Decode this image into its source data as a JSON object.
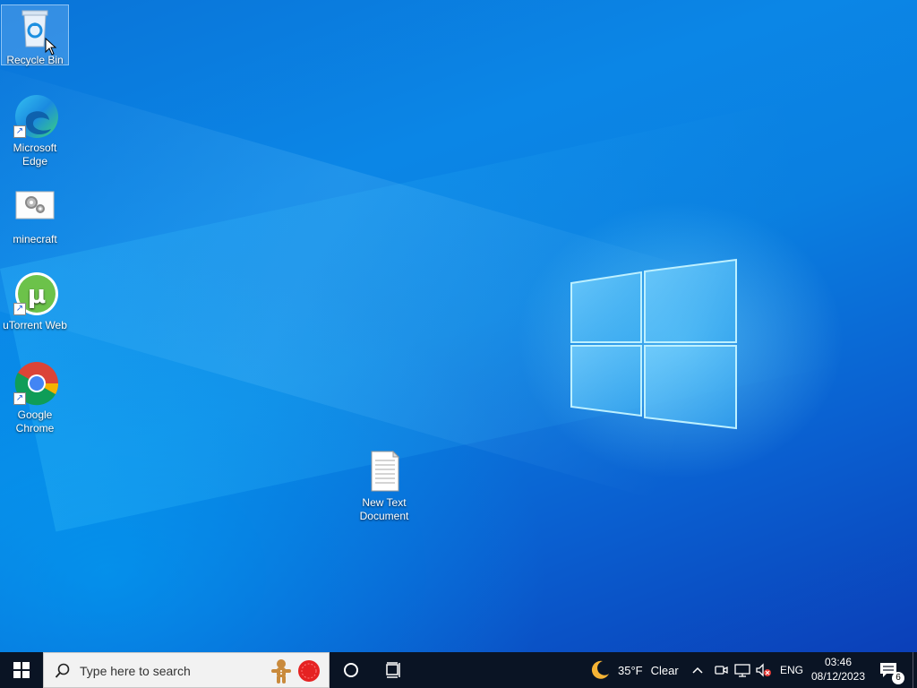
{
  "desktop": {
    "icons": [
      {
        "label": "Recycle Bin",
        "icon": "recycle-bin-icon"
      },
      {
        "label": "Microsoft\nEdge",
        "icon": "microsoft-edge-icon",
        "shortcut": true
      },
      {
        "label": "minecraft",
        "icon": "minecraft-gear-icon"
      },
      {
        "label": "uTorrent Web",
        "icon": "utorrent-icon",
        "shortcut": true
      },
      {
        "label": "Google\nChrome",
        "icon": "google-chrome-icon",
        "shortcut": true
      },
      {
        "label": "New Text\nDocument",
        "icon": "text-document-icon"
      }
    ]
  },
  "taskbar": {
    "search_placeholder": "Type here to search",
    "weather_temp": "35°F",
    "weather_desc": "Clear",
    "language": "ENG",
    "time": "03:46",
    "date": "08/12/2023",
    "notification_count": "6"
  },
  "colors": {
    "taskbar": "#0a1424",
    "desktop_accent": "#0a7fe0"
  }
}
